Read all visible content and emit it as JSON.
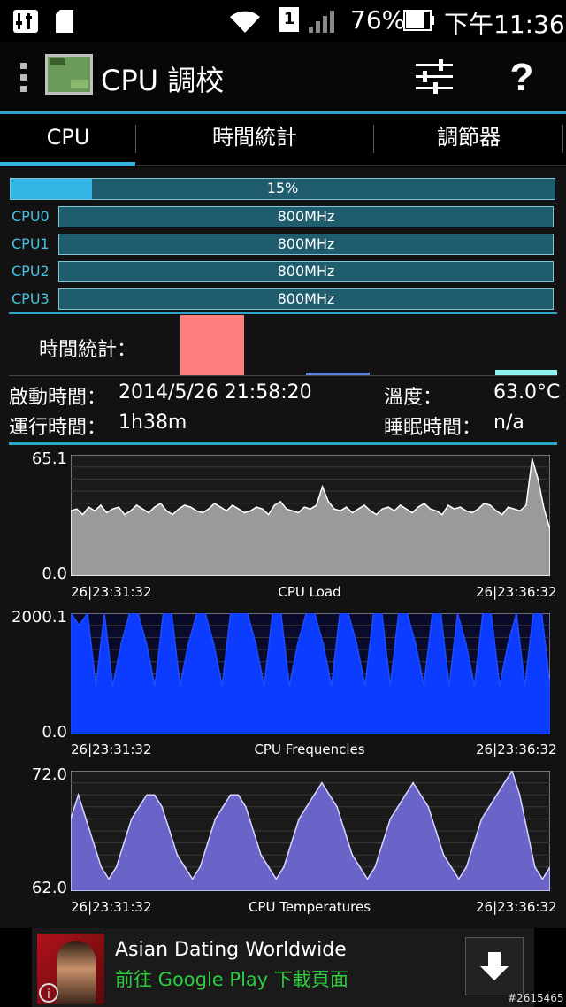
{
  "status_bar": {
    "time": "下午11:36",
    "battery": "76%",
    "sim_slot": "1",
    "icons": [
      "settings-icon",
      "sd-card-icon",
      "wifi-icon",
      "sim-icon",
      "signal-icon",
      "battery-icon"
    ]
  },
  "app": {
    "title": "CPU 調校"
  },
  "tabs": [
    {
      "label": "CPU",
      "selected": true
    },
    {
      "label": "時間統計",
      "selected": false
    },
    {
      "label": "調節器",
      "selected": false
    }
  ],
  "load": {
    "label": "15%",
    "fraction": 0.15
  },
  "cpus": [
    {
      "name": "CPU0",
      "freq": "800MHz"
    },
    {
      "name": "CPU1",
      "freq": "800MHz"
    },
    {
      "name": "CPU2",
      "freq": "800MHz"
    },
    {
      "name": "CPU3",
      "freq": "800MHz"
    }
  ],
  "time_stats": {
    "label": "時間統計："
  },
  "info": {
    "boot_label": "啟動時間：",
    "boot_value": "2014/5/26 21:58:20",
    "temp_label": "溫度：",
    "temp_value": "63.0°C",
    "run_label": "運行時間：",
    "run_value": "1h38m",
    "sleep_label": "睡眠時間：",
    "sleep_value": "n/a"
  },
  "chart_data": [
    {
      "type": "area",
      "title": "CPU Load",
      "ylim": [
        0.0,
        65.1
      ],
      "ymax_label": "65.1",
      "ymin_label": "0.0",
      "x_start": "26|23:31:32",
      "x_end": "26|23:36:32",
      "values": [
        35,
        36,
        33,
        37,
        35,
        38,
        34,
        36,
        37,
        33,
        35,
        38,
        36,
        34,
        37,
        39,
        35,
        33,
        36,
        38,
        37,
        35,
        34,
        36,
        39,
        37,
        35,
        38,
        36,
        34,
        35,
        37,
        36,
        33,
        38,
        40,
        36,
        35,
        34,
        37,
        36,
        38,
        48,
        40,
        36,
        35,
        37,
        34,
        36,
        38,
        35,
        33,
        36,
        37,
        35,
        38,
        36,
        34,
        37,
        39,
        36,
        35,
        33,
        38,
        36,
        37,
        35,
        34,
        36,
        39,
        38,
        35,
        33,
        37,
        36,
        35,
        38,
        63,
        52,
        36,
        25
      ]
    },
    {
      "type": "area",
      "title": "CPU Frequencies",
      "ylim": [
        0.0,
        2000.1
      ],
      "ymax_label": "2000.1",
      "ymin_label": "0.0",
      "x_start": "26|23:31:32",
      "x_end": "26|23:36:32",
      "series": [
        {
          "values": [
            2000,
            1800,
            2000,
            800,
            2000,
            800,
            1500,
            2000,
            2000,
            1500,
            800,
            2000,
            2000,
            800,
            1500,
            2000,
            2000,
            1500,
            800,
            2000,
            2000,
            2000,
            1500,
            800,
            2000,
            2000,
            800,
            1500,
            2000,
            2000,
            1500,
            800,
            2000,
            2000,
            1500,
            800,
            2000,
            2000,
            800,
            2000,
            2000,
            1500,
            800,
            2000,
            2000,
            800,
            2000,
            1500,
            800,
            2000,
            2000,
            800,
            1500,
            2000,
            800,
            2000,
            2000,
            800
          ]
        }
      ]
    },
    {
      "type": "area",
      "title": "CPU Temperatures",
      "ylim": [
        62.0,
        72.0
      ],
      "ymax_label": "72.0",
      "ymin_label": "62.0",
      "x_start": "26|23:31:32",
      "x_end": "26|23:36:32",
      "values": [
        68,
        70,
        68,
        66,
        64,
        63,
        64,
        66,
        68,
        69,
        70,
        70,
        69,
        67,
        65,
        64,
        63,
        64,
        66,
        68,
        69,
        70,
        70,
        69,
        67,
        65,
        64,
        63,
        64,
        66,
        68,
        69,
        70,
        71,
        70,
        69,
        67,
        65,
        64,
        63,
        64,
        66,
        68,
        69,
        70,
        71,
        70,
        69,
        67,
        65,
        64,
        63,
        64,
        66,
        68,
        69,
        70,
        71,
        72,
        70,
        67,
        64,
        63,
        64
      ]
    }
  ],
  "ad": {
    "title": "Asian Dating Worldwide",
    "subtitle": "前往 Google Play 下載頁面",
    "watermark": "#2615465"
  },
  "colors": {
    "accent": "#2fa6c9",
    "bar_fill": "#1e5c6e",
    "load_fill": "#33b5e5",
    "pink_bar": "#ff7f7f",
    "freq_blue": "#0b3cff",
    "temp_purple": "#6a64c8",
    "load_grey": "#9a9a9a"
  }
}
